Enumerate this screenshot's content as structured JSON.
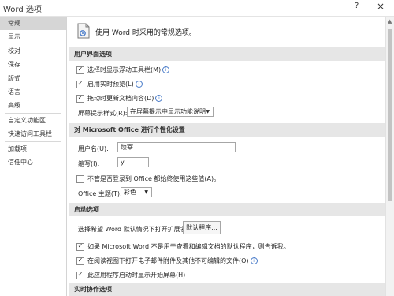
{
  "window": {
    "title": "Word 选项",
    "help": "?",
    "close": "×"
  },
  "sidebar": {
    "items": [
      {
        "label": "常规"
      },
      {
        "label": "显示"
      },
      {
        "label": "校对"
      },
      {
        "label": "保存"
      },
      {
        "label": "版式"
      },
      {
        "label": "语言"
      },
      {
        "label": "高级"
      },
      {
        "label": "自定义功能区"
      },
      {
        "label": "快速访问工具栏"
      },
      {
        "label": "加载项"
      },
      {
        "label": "信任中心"
      }
    ]
  },
  "intro": {
    "text": "使用 Word 时采用的常规选项。"
  },
  "ui_section": {
    "header": "用户界面选项",
    "opt1": "选择时显示浮动工具栏(M)",
    "opt2": "启用实时预览(L)",
    "opt3": "拖动时更新文档内容(D)",
    "tooltip_label": "屏幕提示样式(R):",
    "tooltip_value": "在屏幕提示中显示功能说明"
  },
  "personalize": {
    "header": "对 Microsoft Office 进行个性化设置",
    "username_label": "用户名(U):",
    "username_value": "烦宰",
    "initials_label": "缩写(I):",
    "initials_value": "y",
    "always_use": "不管是否登录到 Office 都始终使用这些值(A)。",
    "theme_label": "Office 主题(T):",
    "theme_value": "彩色"
  },
  "startup": {
    "header": "启动选项",
    "ext_label": "选择希望 Word 默认情况下打开扩展名:",
    "default_programs": "默认程序...",
    "opt_default": "如果 Microsoft Word 不是用于查看和编辑文档的默认程序，则告诉我。",
    "opt_reading": "在阅读视图下打开电子邮件附件及其他不可编辑的文件(O)",
    "opt_start_screen": "此应用程序启动时显示开始屏幕(H)"
  },
  "collab": {
    "header": "实时协作选项"
  },
  "icons": {
    "dropdown": "chevron-down-icon",
    "info": "info-icon",
    "check": "checkmark-icon"
  },
  "colors": {
    "section_bg": "#e6e6e6",
    "active_nav": "#d6d6d6",
    "info_blue": "#4a7cc9"
  }
}
